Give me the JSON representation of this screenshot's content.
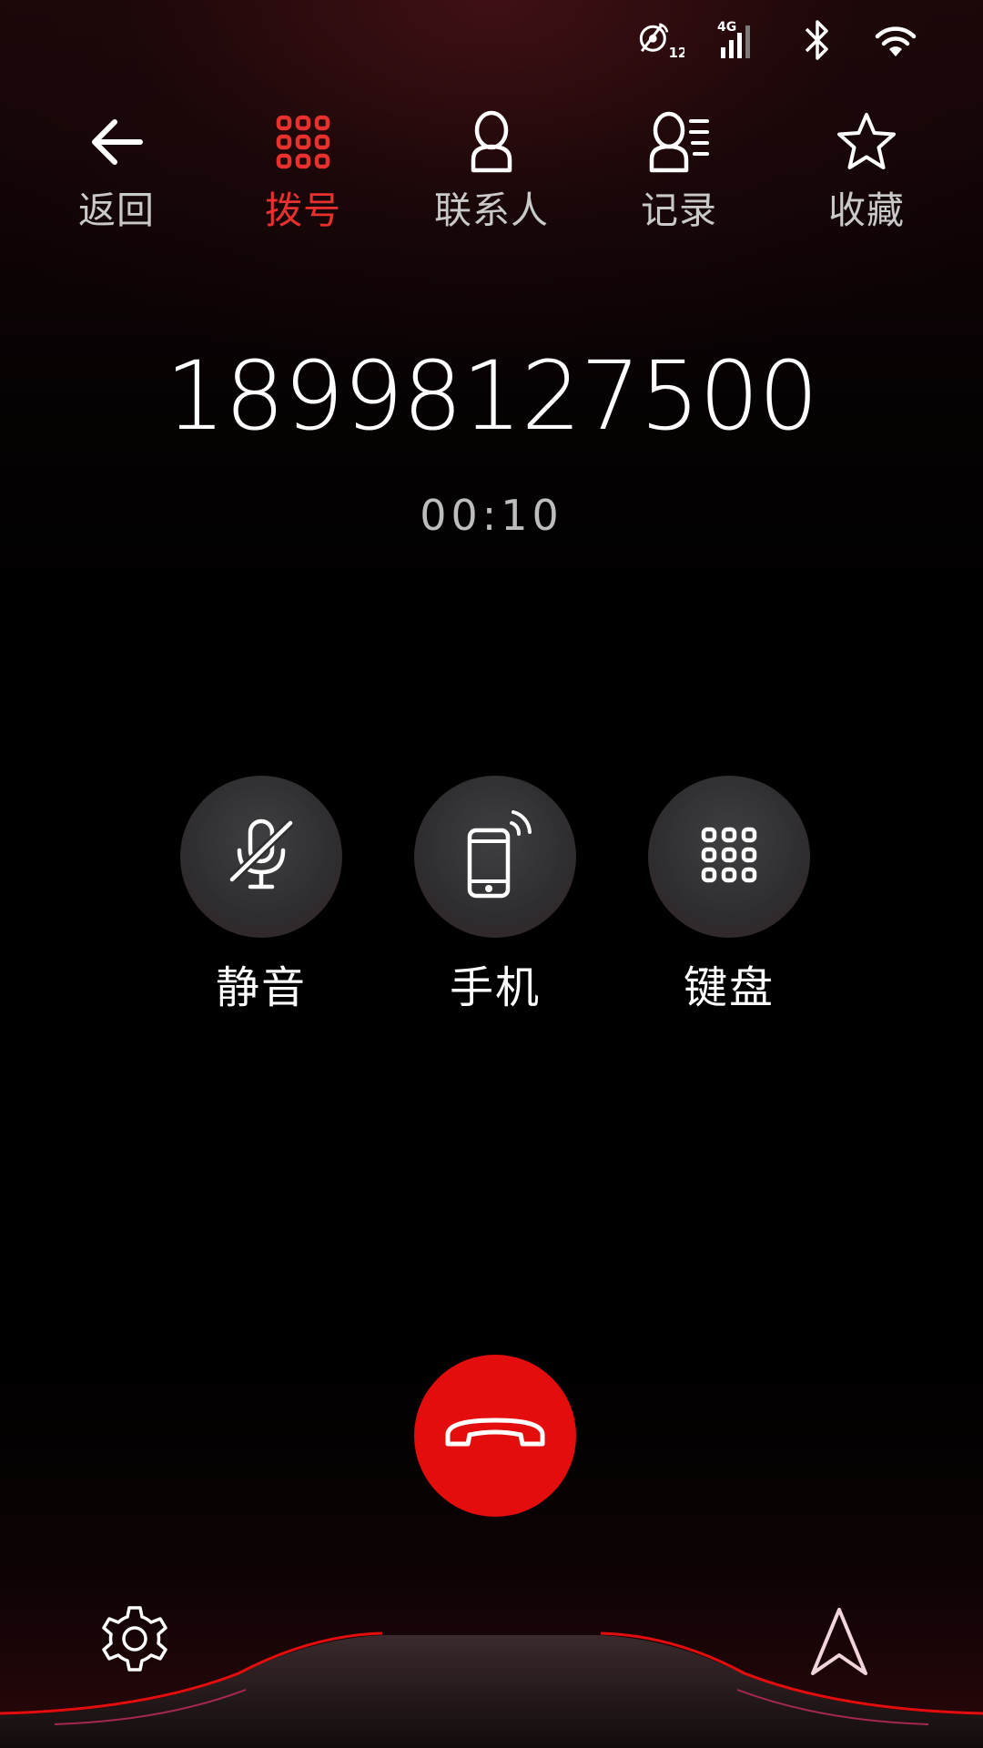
{
  "status_bar": {
    "gps_number": "12",
    "network_type": "4G"
  },
  "nav": {
    "back_label": "返回",
    "dial_label": "拨号",
    "contacts_label": "联系人",
    "history_label": "记录",
    "favorites_label": "收藏"
  },
  "call": {
    "number": "18998127500",
    "duration": "00:10"
  },
  "controls": {
    "mute_label": "静音",
    "phone_label": "手机",
    "keypad_label": "键盘"
  },
  "colors": {
    "accent": "#e8312e",
    "hangup": "#e40d0d"
  },
  "icons": {
    "back": "arrow-left-icon",
    "dial": "dialpad-icon",
    "contacts": "person-icon",
    "history": "person-list-icon",
    "favorites": "star-icon",
    "mute": "microphone-off-icon",
    "phone": "mobile-phone-icon",
    "keypad": "dialpad-icon",
    "hangup": "phone-hangup-icon",
    "settings": "gear-icon",
    "navigation": "navigation-arrow-icon"
  }
}
